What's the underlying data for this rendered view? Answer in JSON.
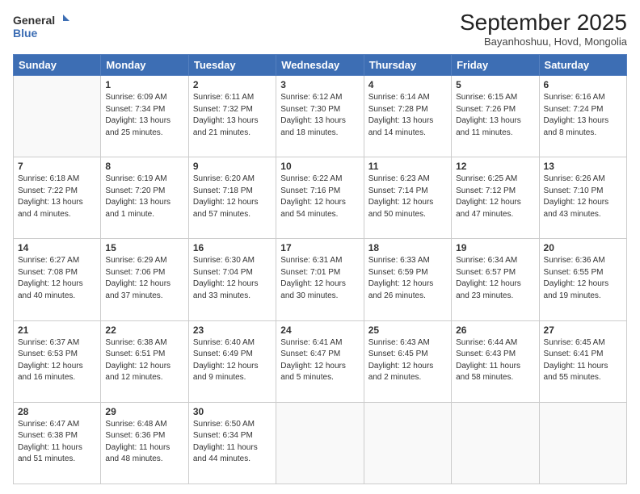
{
  "header": {
    "logo_line1": "General",
    "logo_line2": "Blue",
    "title": "September 2025",
    "subtitle": "Bayanhoshuu, Hovd, Mongolia"
  },
  "weekdays": [
    "Sunday",
    "Monday",
    "Tuesday",
    "Wednesday",
    "Thursday",
    "Friday",
    "Saturday"
  ],
  "weeks": [
    [
      {
        "day": "",
        "info": ""
      },
      {
        "day": "1",
        "info": "Sunrise: 6:09 AM\nSunset: 7:34 PM\nDaylight: 13 hours\nand 25 minutes."
      },
      {
        "day": "2",
        "info": "Sunrise: 6:11 AM\nSunset: 7:32 PM\nDaylight: 13 hours\nand 21 minutes."
      },
      {
        "day": "3",
        "info": "Sunrise: 6:12 AM\nSunset: 7:30 PM\nDaylight: 13 hours\nand 18 minutes."
      },
      {
        "day": "4",
        "info": "Sunrise: 6:14 AM\nSunset: 7:28 PM\nDaylight: 13 hours\nand 14 minutes."
      },
      {
        "day": "5",
        "info": "Sunrise: 6:15 AM\nSunset: 7:26 PM\nDaylight: 13 hours\nand 11 minutes."
      },
      {
        "day": "6",
        "info": "Sunrise: 6:16 AM\nSunset: 7:24 PM\nDaylight: 13 hours\nand 8 minutes."
      }
    ],
    [
      {
        "day": "7",
        "info": "Sunrise: 6:18 AM\nSunset: 7:22 PM\nDaylight: 13 hours\nand 4 minutes."
      },
      {
        "day": "8",
        "info": "Sunrise: 6:19 AM\nSunset: 7:20 PM\nDaylight: 13 hours\nand 1 minute."
      },
      {
        "day": "9",
        "info": "Sunrise: 6:20 AM\nSunset: 7:18 PM\nDaylight: 12 hours\nand 57 minutes."
      },
      {
        "day": "10",
        "info": "Sunrise: 6:22 AM\nSunset: 7:16 PM\nDaylight: 12 hours\nand 54 minutes."
      },
      {
        "day": "11",
        "info": "Sunrise: 6:23 AM\nSunset: 7:14 PM\nDaylight: 12 hours\nand 50 minutes."
      },
      {
        "day": "12",
        "info": "Sunrise: 6:25 AM\nSunset: 7:12 PM\nDaylight: 12 hours\nand 47 minutes."
      },
      {
        "day": "13",
        "info": "Sunrise: 6:26 AM\nSunset: 7:10 PM\nDaylight: 12 hours\nand 43 minutes."
      }
    ],
    [
      {
        "day": "14",
        "info": "Sunrise: 6:27 AM\nSunset: 7:08 PM\nDaylight: 12 hours\nand 40 minutes."
      },
      {
        "day": "15",
        "info": "Sunrise: 6:29 AM\nSunset: 7:06 PM\nDaylight: 12 hours\nand 37 minutes."
      },
      {
        "day": "16",
        "info": "Sunrise: 6:30 AM\nSunset: 7:04 PM\nDaylight: 12 hours\nand 33 minutes."
      },
      {
        "day": "17",
        "info": "Sunrise: 6:31 AM\nSunset: 7:01 PM\nDaylight: 12 hours\nand 30 minutes."
      },
      {
        "day": "18",
        "info": "Sunrise: 6:33 AM\nSunset: 6:59 PM\nDaylight: 12 hours\nand 26 minutes."
      },
      {
        "day": "19",
        "info": "Sunrise: 6:34 AM\nSunset: 6:57 PM\nDaylight: 12 hours\nand 23 minutes."
      },
      {
        "day": "20",
        "info": "Sunrise: 6:36 AM\nSunset: 6:55 PM\nDaylight: 12 hours\nand 19 minutes."
      }
    ],
    [
      {
        "day": "21",
        "info": "Sunrise: 6:37 AM\nSunset: 6:53 PM\nDaylight: 12 hours\nand 16 minutes."
      },
      {
        "day": "22",
        "info": "Sunrise: 6:38 AM\nSunset: 6:51 PM\nDaylight: 12 hours\nand 12 minutes."
      },
      {
        "day": "23",
        "info": "Sunrise: 6:40 AM\nSunset: 6:49 PM\nDaylight: 12 hours\nand 9 minutes."
      },
      {
        "day": "24",
        "info": "Sunrise: 6:41 AM\nSunset: 6:47 PM\nDaylight: 12 hours\nand 5 minutes."
      },
      {
        "day": "25",
        "info": "Sunrise: 6:43 AM\nSunset: 6:45 PM\nDaylight: 12 hours\nand 2 minutes."
      },
      {
        "day": "26",
        "info": "Sunrise: 6:44 AM\nSunset: 6:43 PM\nDaylight: 11 hours\nand 58 minutes."
      },
      {
        "day": "27",
        "info": "Sunrise: 6:45 AM\nSunset: 6:41 PM\nDaylight: 11 hours\nand 55 minutes."
      }
    ],
    [
      {
        "day": "28",
        "info": "Sunrise: 6:47 AM\nSunset: 6:38 PM\nDaylight: 11 hours\nand 51 minutes."
      },
      {
        "day": "29",
        "info": "Sunrise: 6:48 AM\nSunset: 6:36 PM\nDaylight: 11 hours\nand 48 minutes."
      },
      {
        "day": "30",
        "info": "Sunrise: 6:50 AM\nSunset: 6:34 PM\nDaylight: 11 hours\nand 44 minutes."
      },
      {
        "day": "",
        "info": ""
      },
      {
        "day": "",
        "info": ""
      },
      {
        "day": "",
        "info": ""
      },
      {
        "day": "",
        "info": ""
      }
    ]
  ]
}
